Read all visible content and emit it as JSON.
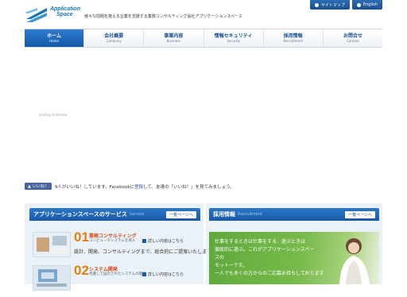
{
  "header": {
    "logo_line1": "Application",
    "logo_line2": "Space",
    "tagline": "様々な問題を抱える企業を支援する業務コンサルティング会社アプリケーションスペース",
    "sitemap_label": "サイトマップ",
    "english_label": "English"
  },
  "nav": {
    "items": [
      {
        "jp": "ホーム",
        "en": "Home"
      },
      {
        "jp": "会社概要",
        "en": "Company"
      },
      {
        "jp": "事業内容",
        "en": "Business"
      },
      {
        "jp": "情報セキュリティ",
        "en": "Security"
      },
      {
        "jp": "採用情報",
        "en": "Recruitment"
      },
      {
        "jp": "お問合せ",
        "en": "Contact"
      }
    ]
  },
  "hero": {
    "caption": "loading slideshow"
  },
  "facebook": {
    "like_label": "いいね！",
    "text_before": "9人がいいね！しています。Facebookに",
    "register_link": "登録",
    "text_after": "して、友達の「いいね！」を見てみましょう。"
  },
  "services": {
    "heading": "アプリケーションスペースのサービス",
    "heading_en": "Service",
    "more_label": "一覧ページへ",
    "items": [
      {
        "num": "01",
        "title": "業務コンサルティング",
        "sub": "コンピュータシステムを導入",
        "detail": "詳しい内容はこちら",
        "desc": "設計、開発、コンサルティングまで、総合的にご提案いたします。"
      },
      {
        "num": "02",
        "title": "システム開発",
        "sub": "考慮して設計されたシステムの開発",
        "detail": "詳しい内容はこちら",
        "desc": ""
      }
    ]
  },
  "recruit": {
    "heading": "採用情報",
    "heading_en": "Recruitment",
    "more_label": "一覧ページへ",
    "line1": "仕事をするときは仕事をする、遊ぶときは",
    "line2": "徹底的に遊ぶ。これがアプリケーションスペースの",
    "line3": "モットーです。",
    "line4": "一人でも多くの方からのご応募お待ちしております"
  },
  "colors": {
    "brand": "#1a5aa8",
    "accent_orange": "#e0800e",
    "nav_active": "#2e7bd0",
    "recruit_green": "#6fb144"
  }
}
